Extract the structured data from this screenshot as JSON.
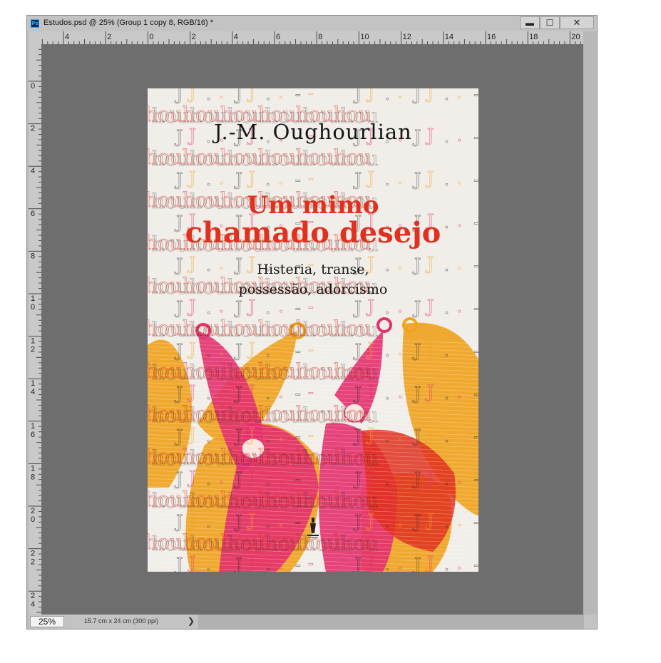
{
  "window": {
    "title": "Estudos.psd @ 25% (Group 1 copy 8, RGB/16) *",
    "app_icon": "Ps",
    "controls": {
      "minimize": "▬",
      "maximize": "☐",
      "close": "✕"
    }
  },
  "ruler_top_labels": [
    "4",
    "2",
    "0",
    "2",
    "4",
    "6",
    "8",
    "10",
    "12",
    "14",
    "16",
    "18",
    "20"
  ],
  "ruler_left_labels": [
    "0",
    "2",
    "4",
    "6",
    "8",
    "1 0",
    "1 2",
    "1 4",
    "1 6",
    "1 8",
    "2 0",
    "2 2",
    "2 4"
  ],
  "cover": {
    "author": "J.-M. Oughourlian",
    "title_line1": "Um mimo",
    "title_line2": "chamado desejo",
    "subtitle_line1": "Histeria, transe,",
    "subtitle_line2": "possessão, adorcismo",
    "pattern_text_1": "J.J.- J.J.- J.J.-",
    "pattern_text_2": "houhouhouhouhouhou",
    "colors": {
      "red": "#e0301e",
      "magenta": "#e3306e",
      "orange": "#f0a31f",
      "paper": "#f1eeea"
    }
  },
  "status": {
    "zoom": "25%",
    "doc_info": "15.7 cm x 24 cm (300 ppi)",
    "arrow": "❯"
  }
}
